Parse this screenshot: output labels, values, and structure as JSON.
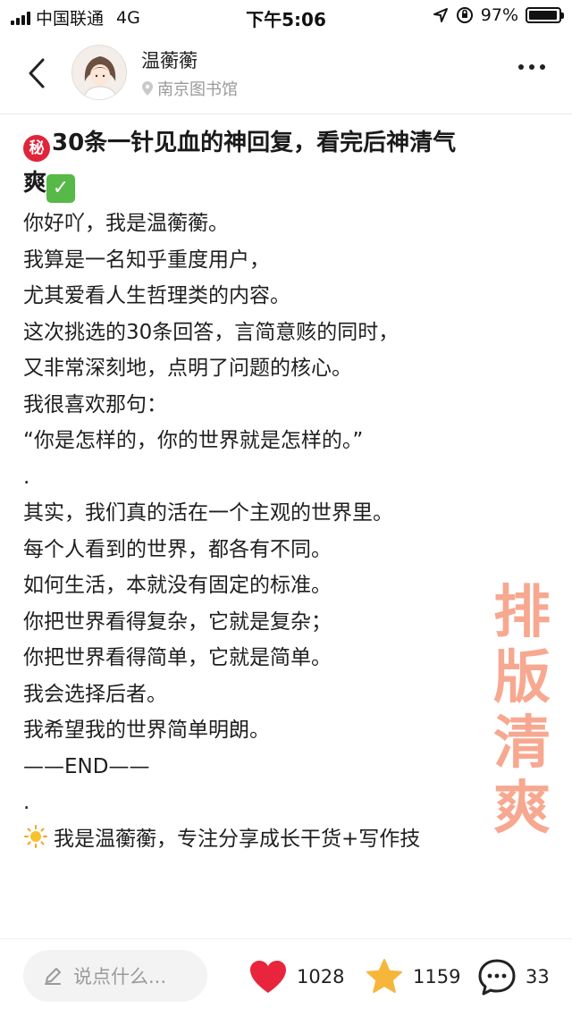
{
  "status_bar": {
    "carrier": "中国联通",
    "network": "4G",
    "time": "下午5:06",
    "battery_percent": "97%",
    "battery_level": 0.97
  },
  "header": {
    "author_name": "温蘅蘅",
    "location": "南京图书馆",
    "back_icon": "chevron-left-icon",
    "more_icon": "more-horizontal-icon"
  },
  "post": {
    "title_emoji_secret": "秘",
    "title": "30条一针见血的神回复，看完后神清气爽",
    "title_line1": "30条一针见血的神回复，看完后神清气",
    "title_line2": "爽",
    "title_emoji_check": "✓",
    "lines": [
      "你好吖，我是温蘅蘅。",
      "我算是一名知乎重度用户，",
      "尤其爱看人生哲理类的内容。",
      "这次挑选的30条回答，言简意赅的同时，",
      "又非常深刻地，点明了问题的核心。",
      "我很喜欢那句：",
      "“你是怎样的，你的世界就是怎样的。”",
      ".",
      "其实，我们真的活在一个主观的世界里。",
      "每个人看到的世界，都各有不同。",
      "如何生活，本就没有固定的标准。",
      "你把世界看得复杂，它就是复杂；",
      "你把世界看得简单，它就是简单。",
      "我会选择后者。",
      "我希望我的世界简单明朗。",
      "——END——",
      ".",
      "我是温蘅蘅，专注分享成长干货+写作技"
    ],
    "watermark": [
      "排",
      "版",
      "清",
      "爽"
    ]
  },
  "bottom_bar": {
    "comment_placeholder": "说点什么...",
    "likes": "1028",
    "stars": "1159",
    "comments": "33",
    "colors": {
      "like": "#e8253c",
      "star": "#f6b63a"
    }
  }
}
